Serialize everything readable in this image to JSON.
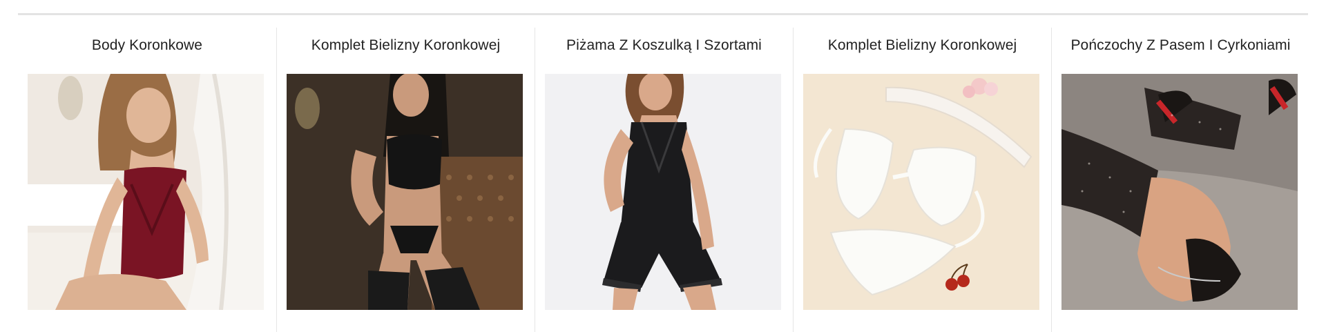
{
  "products": [
    {
      "title": "Body Koronkowe",
      "image_subject": "burgundy lace bodysuit photo"
    },
    {
      "title": "Komplet Bielizny Koronkowej",
      "image_subject": "black lace lingerie set with stockings photo"
    },
    {
      "title": "Piżama Z Koszulką I Szortami",
      "image_subject": "black satin cami and shorts pajama photo"
    },
    {
      "title": "Komplet Bielizny Koronkowej",
      "image_subject": "white lace lingerie set flat lay photo"
    },
    {
      "title": "Pończochy Z Pasem I Cyrkoniami",
      "image_subject": "rhinestone fishnet stockings with red-sole heels photo"
    }
  ],
  "colors": {
    "divider": "#e3e3e3",
    "title_text": "#222222",
    "burgundy_lace": "#7a1424",
    "black_lace": "#141414",
    "white_lace": "#fbfbf8",
    "red_sole": "#c8262a"
  }
}
